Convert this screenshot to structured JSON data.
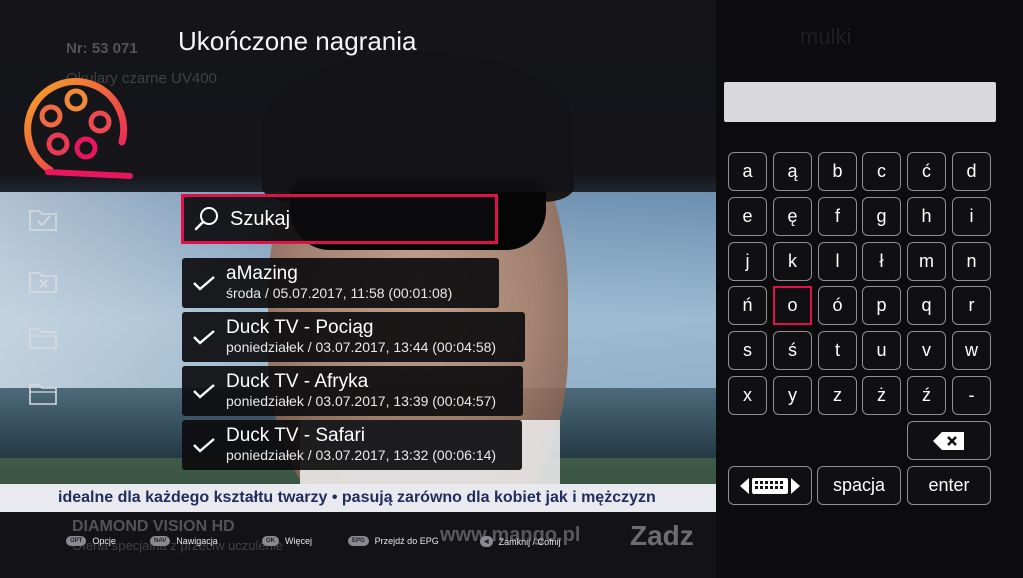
{
  "screen": {
    "title": "Ukończone nagrania",
    "background": {
      "order_number": "Nr: 53 071",
      "product": "Okulary czarne UV400",
      "ticker": "idealne dla każdego kształtu twarzy  •  pasują zarówno dla kobiet jak i mężczyzn",
      "channel": "DIAMOND VISION HD",
      "channel_sub": "Oferta specjalna z przeciw uczulenie",
      "website": "www.mango.pl",
      "call": "Zadz",
      "ghost_brand": "mulki"
    }
  },
  "search": {
    "label": "Szukaj",
    "icon": "search-icon"
  },
  "recordings": [
    {
      "name": "aMazing",
      "meta": "środa / 05.07.2017, 11:58 (00:01:08)"
    },
    {
      "name": "Duck TV - Pociąg",
      "meta": "poniedziałek / 03.07.2017, 13:44 (00:04:58)"
    },
    {
      "name": "Duck TV - Afryka",
      "meta": "poniedziałek / 03.07.2017, 13:39 (00:04:57)"
    },
    {
      "name": "Duck TV - Safari",
      "meta": "poniedziałek / 03.07.2017, 13:32 (00:06:14)"
    }
  ],
  "keyboard": {
    "input_value": "",
    "rows": [
      [
        "a",
        "ą",
        "b",
        "c",
        "ć",
        "d"
      ],
      [
        "e",
        "ę",
        "f",
        "g",
        "h",
        "i"
      ],
      [
        "j",
        "k",
        "l",
        "ł",
        "m",
        "n"
      ],
      [
        "ń",
        "o",
        "ó",
        "p",
        "q",
        "r"
      ],
      [
        "s",
        "ś",
        "t",
        "u",
        "v",
        "w"
      ],
      [
        "x",
        "y",
        "z",
        "ż",
        "ź",
        "-"
      ]
    ],
    "selected_key": "o",
    "space_label": "spacja",
    "enter_label": "enter"
  },
  "footer": {
    "hints": [
      {
        "badge": "OPT",
        "label": "Opcje"
      },
      {
        "badge": "NAV",
        "label": "Nawigacja"
      },
      {
        "badge": "OK",
        "label": "Więcej"
      },
      {
        "badge": "EPG",
        "label": "Przejdź do EPG"
      },
      {
        "badge": "◀",
        "label": "Zamknij / Cofnij"
      }
    ]
  },
  "colors": {
    "accent": "#e0104a",
    "logo_orange": "#f5a623",
    "logo_pink": "#e8175d"
  }
}
